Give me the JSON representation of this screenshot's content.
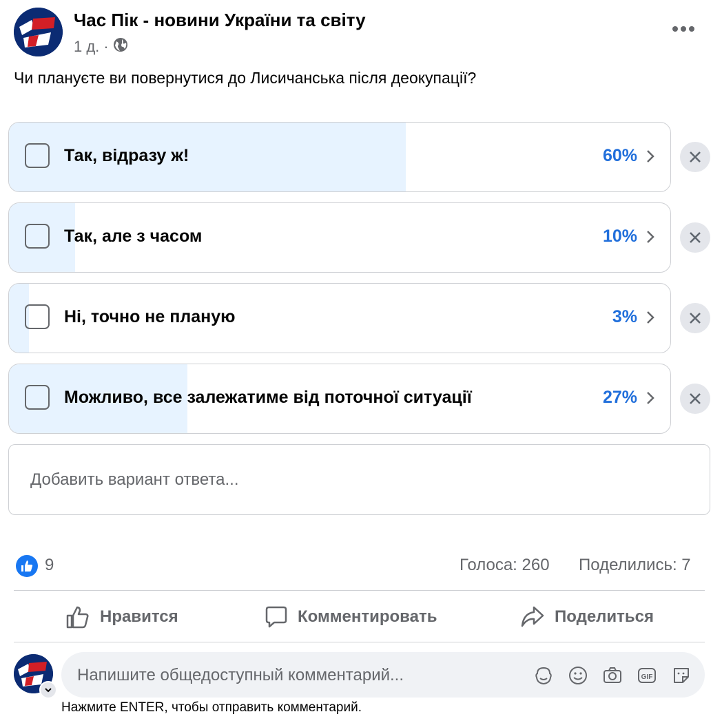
{
  "post": {
    "page_name": "Час Пік - новини України та світу",
    "time": "1 д.",
    "separator": "·",
    "audience_icon": "globe-icon",
    "question": "Чи плануєте ви повернутися до Лисичанська після деокупації?"
  },
  "poll": {
    "options": [
      {
        "label": "Так, відразу ж!",
        "percent_text": "60%",
        "percent": 60
      },
      {
        "label": "Так, але з часом",
        "percent_text": "10%",
        "percent": 10
      },
      {
        "label": "Ні, точно не планую",
        "percent_text": "3%",
        "percent": 3
      },
      {
        "label": "Можливо, все залежатиме від поточної ситуації",
        "percent_text": "27%",
        "percent": 27
      }
    ],
    "add_option_placeholder": "Добавить вариант ответа..."
  },
  "stats": {
    "likes": "9",
    "votes": "Голоса: 260",
    "shares": "Поделились: 7"
  },
  "actions": {
    "like": "Нравится",
    "comment": "Комментировать",
    "share": "Поделиться"
  },
  "comment": {
    "placeholder": "Напишите общедоступный комментарий...",
    "hint": "Нажмите ENTER, чтобы отправить комментарий.",
    "icons": [
      "avatar-sticker-icon",
      "emoji-icon",
      "camera-icon",
      "gif-icon",
      "sticker-icon"
    ]
  },
  "colors": {
    "accent": "#216fdb",
    "fill": "#e7f3ff",
    "secondary_text": "#65676b",
    "like_blue": "#1877f2"
  }
}
